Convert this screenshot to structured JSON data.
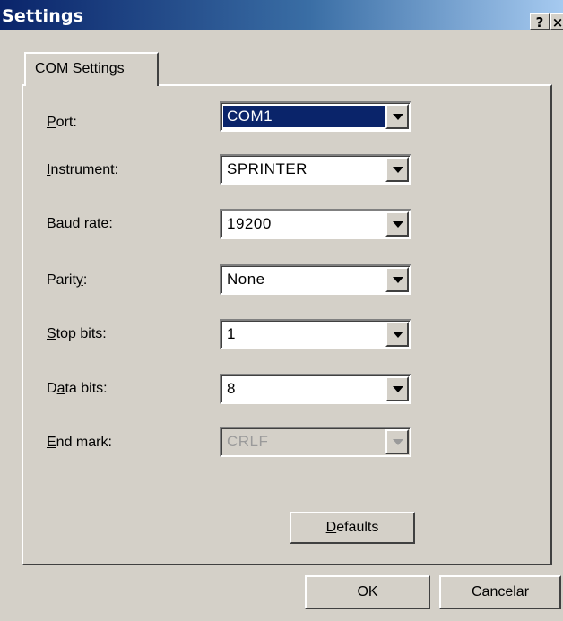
{
  "window": {
    "title": "Settings",
    "help_button": "?",
    "close_button": "×"
  },
  "tabs": [
    {
      "label": "COM Settings",
      "active": true
    }
  ],
  "fields": [
    {
      "label": "Port:",
      "mnemonic": "P",
      "value": "COM1",
      "selected": true,
      "enabled": true
    },
    {
      "label": "Instrument:",
      "mnemonic": "I",
      "value": "SPRINTER",
      "enabled": true
    },
    {
      "label": "Baud rate:",
      "mnemonic": "B",
      "value": "19200",
      "enabled": true
    },
    {
      "label": "Parity:",
      "mnemonic": "y",
      "value": "None",
      "enabled": true
    },
    {
      "label": "Stop bits:",
      "mnemonic": "S",
      "value": "1",
      "enabled": true
    },
    {
      "label": "Data bits:",
      "mnemonic": "a",
      "value": "8",
      "enabled": true
    },
    {
      "label": "End mark:",
      "mnemonic": "E",
      "value": "CRLF",
      "enabled": false
    }
  ],
  "buttons": {
    "defaults": "Defaults",
    "ok": "OK",
    "cancel": "Cancelar"
  },
  "colors": {
    "titlebar_start": "#0a246a",
    "titlebar_end": "#a6caf0",
    "face": "#d4d0c8",
    "selection": "#0a246a"
  }
}
